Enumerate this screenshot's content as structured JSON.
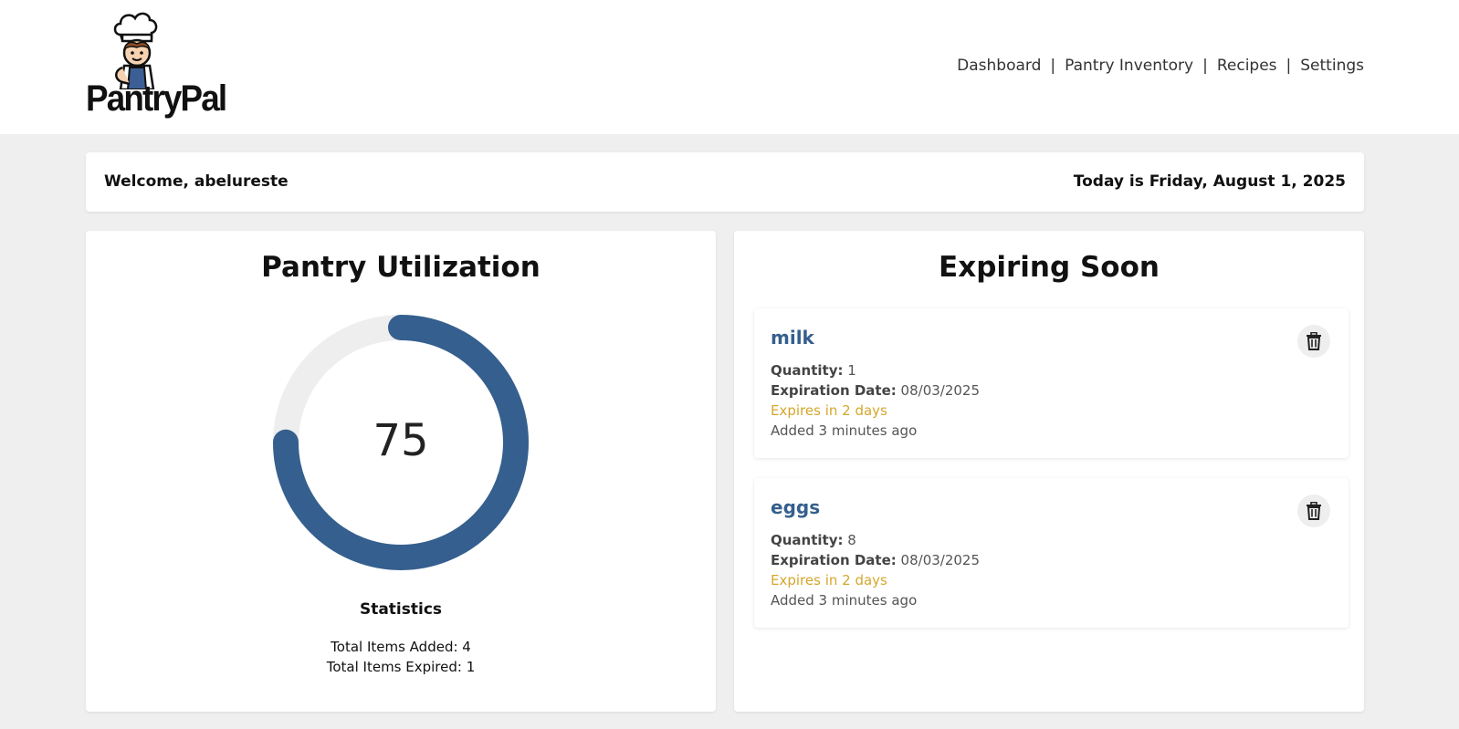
{
  "header": {
    "logo_text": "PantryPal",
    "nav": {
      "dashboard": "Dashboard",
      "pantry_inventory": "Pantry Inventory",
      "recipes": "Recipes",
      "settings": "Settings",
      "separator": "|"
    }
  },
  "welcome": {
    "greeting": "Welcome, abelureste",
    "date": "Today is Friday, August 1, 2025"
  },
  "utilization": {
    "title": "Pantry Utilization",
    "value": "75",
    "percent": 75,
    "stats_title": "Statistics",
    "total_added": "Total Items Added: 4",
    "total_expired": "Total Items Expired: 1"
  },
  "expiring": {
    "title": "Expiring Soon",
    "items": [
      {
        "name": "milk",
        "quantity_label": "Quantity:",
        "quantity": "1",
        "expiration_label": "Expiration Date:",
        "expiration": "08/03/2025",
        "expires_in": "Expires in 2 days",
        "added": "Added 3 minutes ago"
      },
      {
        "name": "eggs",
        "quantity_label": "Quantity:",
        "quantity": "8",
        "expiration_label": "Expiration Date:",
        "expiration": "08/03/2025",
        "expires_in": "Expires in 2 days",
        "added": "Added 3 minutes ago"
      }
    ]
  },
  "colors": {
    "accent": "#355f8e",
    "warning": "#d4a72c",
    "background": "#efefef",
    "track": "#eeeeee"
  },
  "icons": {
    "logo": "chef-mascot-icon",
    "delete": "trash-icon"
  }
}
